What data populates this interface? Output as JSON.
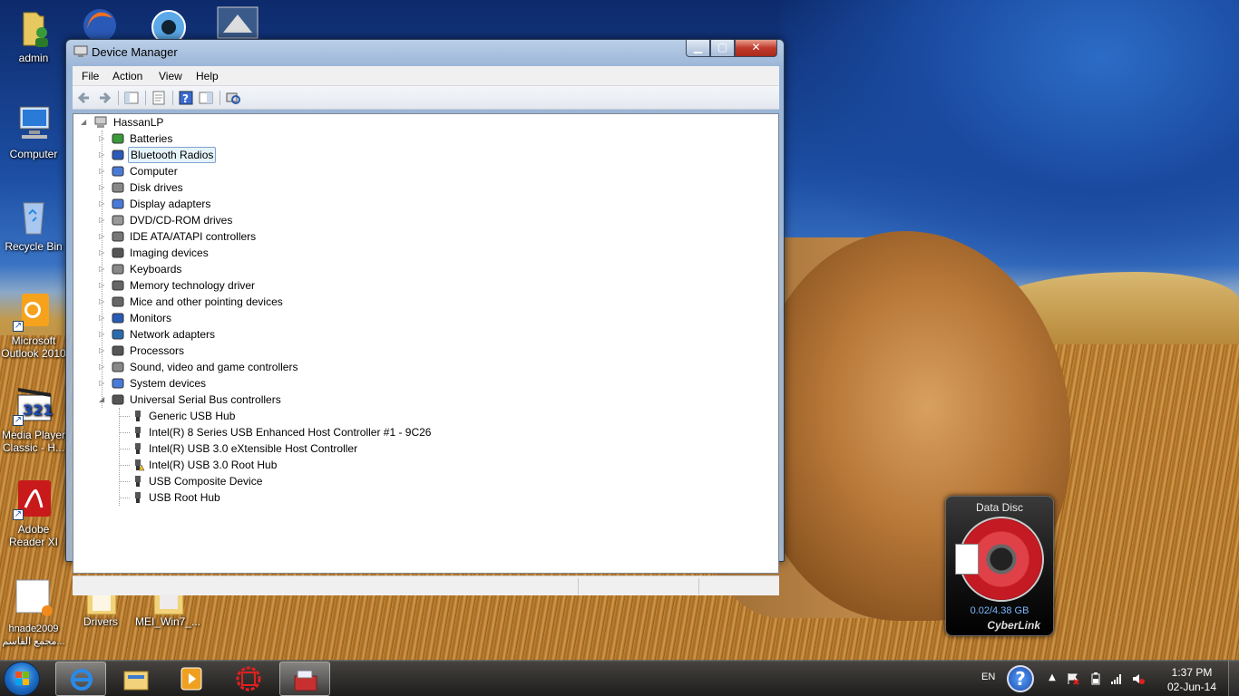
{
  "desktop": {
    "icons": [
      {
        "label": "admin"
      },
      {
        "label": "Computer"
      },
      {
        "label": "Recycle Bin"
      },
      {
        "label": "Microsoft Outlook 2010"
      },
      {
        "label": "Media Player Classic - H..."
      },
      {
        "label": "Adobe Reader XI"
      },
      {
        "label": "hnade2009 مجمع القاسم..."
      },
      {
        "label": "Drivers"
      },
      {
        "label": "MEI_Win7_..."
      }
    ]
  },
  "window": {
    "title": "Device Manager",
    "controls": {
      "minimize": "▁",
      "maximize": "▢",
      "close": "✕"
    },
    "menu": [
      "File",
      "Action",
      "View",
      "Help"
    ],
    "tree": {
      "root": "HassanLP",
      "categories": [
        "Batteries",
        "Bluetooth Radios",
        "Computer",
        "Disk drives",
        "Display adapters",
        "DVD/CD-ROM drives",
        "IDE ATA/ATAPI controllers",
        "Imaging devices",
        "Keyboards",
        "Memory technology driver",
        "Mice and other pointing devices",
        "Monitors",
        "Network adapters",
        "Processors",
        "Sound, video and game controllers",
        "System devices",
        "Universal Serial Bus controllers"
      ],
      "selected": "Bluetooth Radios",
      "expanded": "Universal Serial Bus controllers",
      "usb_children": [
        "Generic USB Hub",
        "Intel(R) 8 Series USB Enhanced Host Controller #1 - 9C26",
        "Intel(R) USB 3.0 eXtensible Host Controller",
        "Intel(R) USB 3.0 Root Hub",
        "USB Composite Device",
        "USB Root Hub"
      ],
      "warning_device": "Intel(R) USB 3.0 Root Hub"
    }
  },
  "gadget": {
    "title": "Data Disc",
    "size": "0.02/4.38 GB",
    "brand": "CyberLink"
  },
  "taskbar": {
    "lang": "EN",
    "help": "?",
    "time": "1:37 PM",
    "date": "02-Jun-14"
  },
  "colors": {
    "selection": "#e5f3fb",
    "close_button": "#c0392b",
    "warning": "#f0c020"
  }
}
